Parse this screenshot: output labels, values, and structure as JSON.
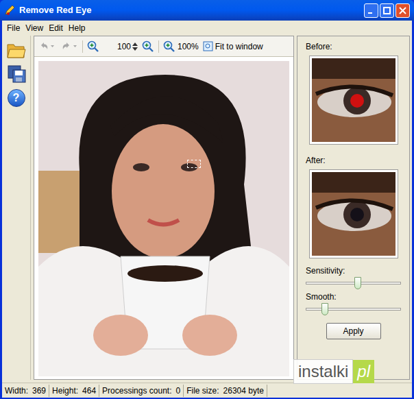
{
  "window": {
    "title": "Remove Red Eye"
  },
  "menu": [
    {
      "label": "File"
    },
    {
      "label": "View"
    },
    {
      "label": "Edit"
    },
    {
      "label": "Help"
    }
  ],
  "side_toolbar": {
    "help_glyph": "?"
  },
  "toolbar": {
    "history": [
      {
        "name": "undo",
        "disabled": true
      },
      {
        "name": "redo",
        "disabled": true
      }
    ],
    "zoom_value": "100",
    "zoom_percent": "100%",
    "fit": "Fit to window"
  },
  "preview": {
    "before_label": "Before:",
    "after_label": "After:"
  },
  "sliders": [
    {
      "label": "Sensitivity:",
      "level": 0.55
    },
    {
      "label": "Smooth:",
      "level": 0.2
    }
  ],
  "apply": "Apply",
  "status_bar": [
    {
      "label": "Width:",
      "value": "369"
    },
    {
      "label": "Height:",
      "value": "464"
    },
    {
      "label": "Processings count:",
      "value": "0"
    },
    {
      "label": "File size:",
      "value": "26304 byte"
    }
  ],
  "watermark": {
    "text": "instalki",
    "suffix": "pl"
  }
}
